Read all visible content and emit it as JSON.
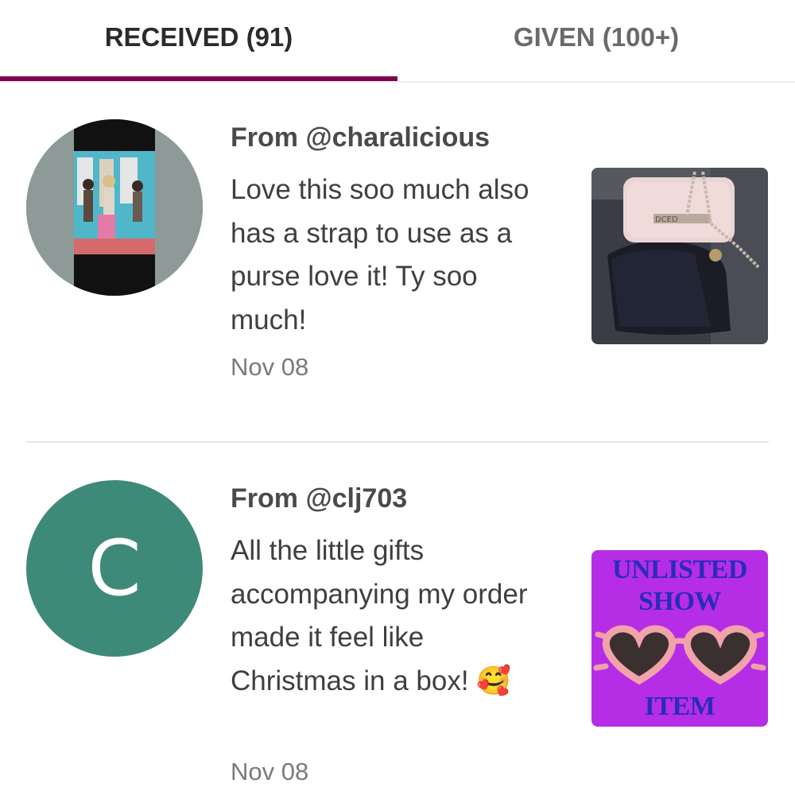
{
  "tabs": {
    "received_label": "RECEIVED (91)",
    "given_label": "GIVEN (100+)"
  },
  "colors": {
    "accent": "#7f0353",
    "avatar_green": "#3e8a78",
    "unlisted_bg": "#b52ee6",
    "unlisted_text": "#2b2bb8"
  },
  "reviews": [
    {
      "from_prefix": "From",
      "handle": "@charalicious",
      "comment": "Love this soo much also has a strap to use as a purse love it! Ty soo much!",
      "date": "Nov 08",
      "avatar": "photo",
      "thumbnail": "pink-bag-photo"
    },
    {
      "from_prefix": "From",
      "handle": "@clj703",
      "comment": "All the little gifts accompanying my order made it feel like Christmas in a box!",
      "emoji": "🥰",
      "date": "Nov 08",
      "avatar_letter": "C",
      "thumbnail_lines": [
        "UNLISTED",
        "SHOW",
        "ITEM"
      ]
    }
  ]
}
